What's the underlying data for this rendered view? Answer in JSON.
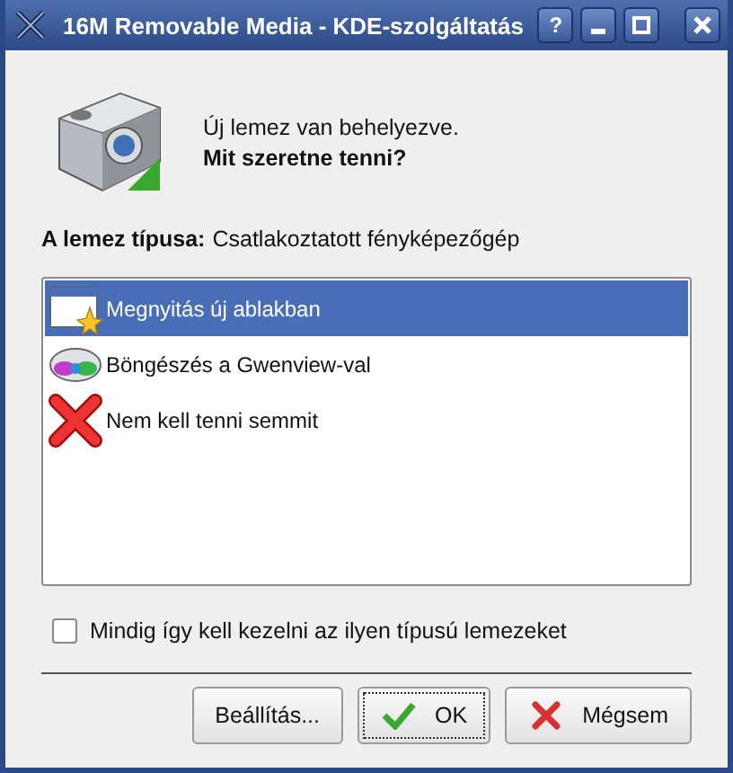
{
  "window": {
    "title": "16M Removable Media - KDE-szolgáltatás",
    "controls": [
      {
        "kind": "help",
        "label": "?"
      },
      {
        "kind": "minimize"
      },
      {
        "kind": "maximize"
      },
      {
        "kind": "close"
      }
    ]
  },
  "message": {
    "line": "Új lemez van behelyezve.",
    "question": "Mit szeretne tenni?"
  },
  "media_type": {
    "label": "A lemez típusa:",
    "value": "Csatlakoztatott fényképezőgép"
  },
  "actions": [
    {
      "kind": "window",
      "label": "Megnyitás új ablakban",
      "selected": true
    },
    {
      "kind": "viewer",
      "label": "Böngészés a Gwenview-val",
      "selected": false
    },
    {
      "kind": "nothing",
      "label": "Nem kell tenni semmit",
      "selected": false
    }
  ],
  "remember": {
    "label": "Mindig így kell kezelni az ilyen típusú lemezeket",
    "checked": false
  },
  "buttons": [
    {
      "kind": "settings",
      "label": "Beállítás..."
    },
    {
      "kind": "ok",
      "label": "OK",
      "focused": true
    },
    {
      "kind": "cancel",
      "label": "Mégsem"
    }
  ]
}
